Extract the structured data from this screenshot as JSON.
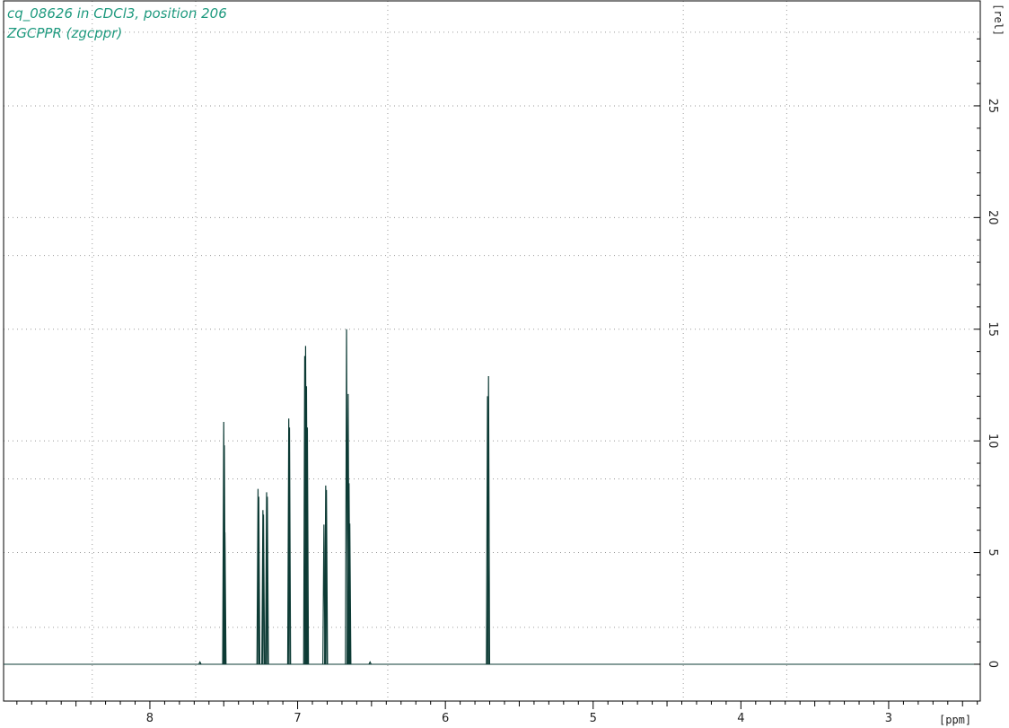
{
  "header": {
    "line1": "cq_08626 in CDCl3, position 206",
    "line2": "ZGCPPR (zgcppr)"
  },
  "colors": {
    "spectrum": "#0d3b35",
    "header_text": "#1f9a7f",
    "grid": "#9a9a9a",
    "frame": "#000000"
  },
  "chart_data": {
    "type": "line",
    "title": "",
    "xlabel": "[ppm]",
    "ylabel": "[rel]",
    "x_reversed": true,
    "xlim": [
      8.99,
      2.38
    ],
    "ylim": [
      -1.65,
      29.7
    ],
    "grid": true,
    "x_ticks": [
      8,
      7,
      6,
      5,
      4,
      3
    ],
    "x_tick_labels": [
      "8",
      "7",
      "6",
      "5",
      "4",
      "3"
    ],
    "x_minor_step": 0.1,
    "y_ticks": [
      0,
      5,
      10,
      15,
      20,
      25
    ],
    "y_tick_labels": [
      "0",
      "5",
      "10",
      "15",
      "20",
      "25"
    ],
    "x_gridlines": [
      8.39,
      7.69,
      6.39,
      4.39,
      3.69
    ],
    "y_gridlines": [
      0,
      1.65,
      5,
      8.3,
      10,
      15,
      18.3,
      20,
      25,
      28.3
    ],
    "peaks": [
      {
        "ppm": 7.661,
        "height": 0.1
      },
      {
        "ppm": 7.5,
        "height": 10.85
      },
      {
        "ppm": 7.496,
        "height": 9.8
      },
      {
        "ppm": 7.492,
        "height": 5.9
      },
      {
        "ppm": 7.268,
        "height": 7.85
      },
      {
        "ppm": 7.263,
        "height": 7.5
      },
      {
        "ppm": 7.235,
        "height": 6.9
      },
      {
        "ppm": 7.231,
        "height": 6.7
      },
      {
        "ppm": 7.21,
        "height": 7.7
      },
      {
        "ppm": 7.205,
        "height": 7.5
      },
      {
        "ppm": 7.06,
        "height": 11.0
      },
      {
        "ppm": 7.055,
        "height": 10.6
      },
      {
        "ppm": 6.952,
        "height": 13.8
      },
      {
        "ppm": 6.946,
        "height": 14.25
      },
      {
        "ppm": 6.94,
        "height": 12.45
      },
      {
        "ppm": 6.934,
        "height": 10.6
      },
      {
        "ppm": 6.822,
        "height": 6.25
      },
      {
        "ppm": 6.81,
        "height": 8.0
      },
      {
        "ppm": 6.805,
        "height": 7.8
      },
      {
        "ppm": 6.669,
        "height": 15.0
      },
      {
        "ppm": 6.658,
        "height": 12.1
      },
      {
        "ppm": 6.652,
        "height": 8.1
      },
      {
        "ppm": 6.647,
        "height": 6.3
      },
      {
        "ppm": 6.51,
        "height": 0.1
      },
      {
        "ppm": 5.715,
        "height": 12.0
      },
      {
        "ppm": 5.708,
        "height": 12.9
      }
    ]
  }
}
